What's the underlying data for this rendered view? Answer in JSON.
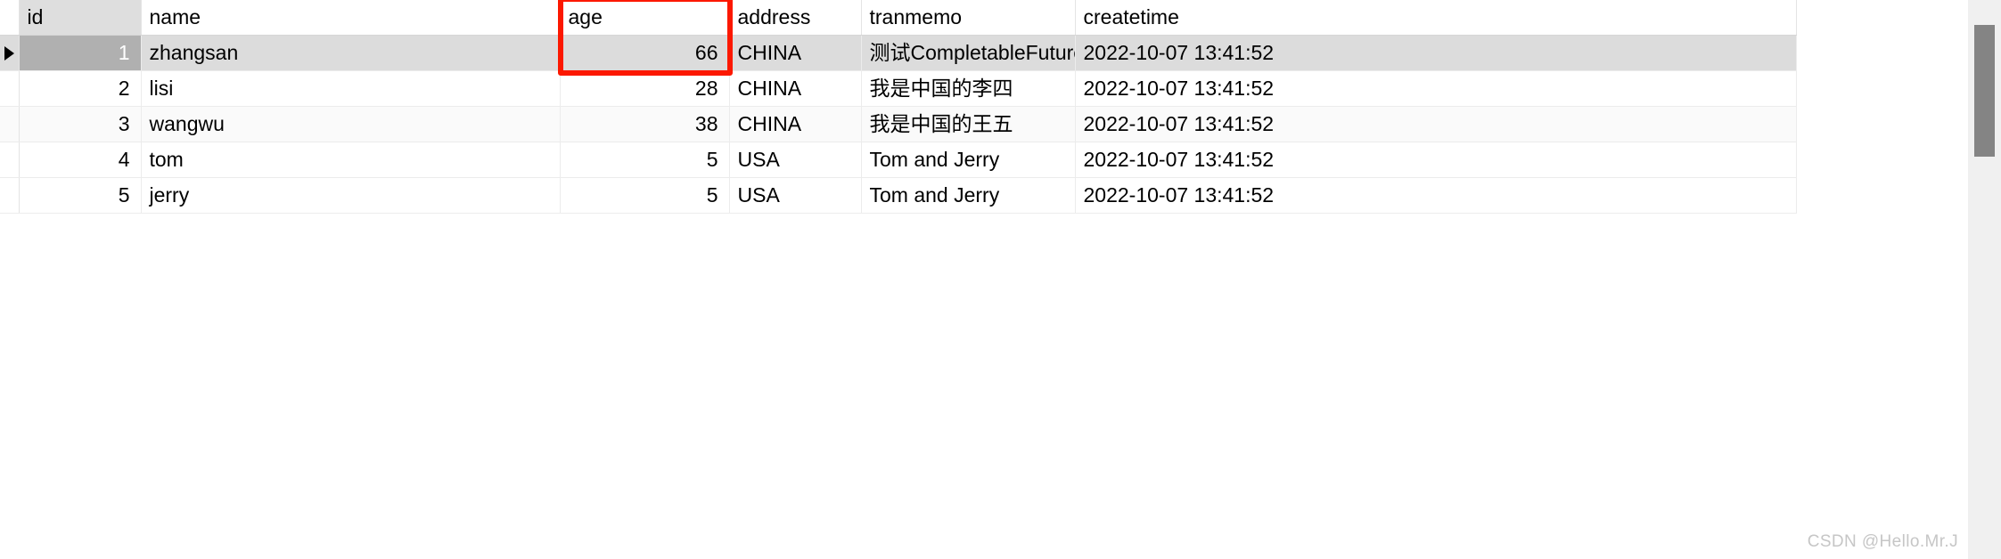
{
  "grid": {
    "columns": [
      {
        "key": "id",
        "label": "id",
        "align": "right"
      },
      {
        "key": "name",
        "label": "name",
        "align": "left"
      },
      {
        "key": "age",
        "label": "age",
        "align": "right"
      },
      {
        "key": "address",
        "label": "address",
        "align": "left"
      },
      {
        "key": "tranmemo",
        "label": "tranmemo",
        "align": "left"
      },
      {
        "key": "createtime",
        "label": "createtime",
        "align": "left"
      }
    ],
    "rows": [
      {
        "id": "1",
        "name": "zhangsan",
        "age": "66",
        "address": "CHINA",
        "tranmemo": "测试CompletableFuture事务问题",
        "createtime": "2022-10-07 13:41:52"
      },
      {
        "id": "2",
        "name": "lisi",
        "age": "28",
        "address": "CHINA",
        "tranmemo": "我是中国的李四",
        "createtime": "2022-10-07 13:41:52"
      },
      {
        "id": "3",
        "name": "wangwu",
        "age": "38",
        "address": "CHINA",
        "tranmemo": "我是中国的王五",
        "createtime": "2022-10-07 13:41:52"
      },
      {
        "id": "4",
        "name": "tom",
        "age": "5",
        "address": "USA",
        "tranmemo": "Tom and Jerry",
        "createtime": "2022-10-07 13:41:52"
      },
      {
        "id": "5",
        "name": "jerry",
        "age": "5",
        "address": "USA",
        "tranmemo": "Tom and Jerry",
        "createtime": "2022-10-07 13:41:52"
      }
    ],
    "selected_row_index": 0,
    "selected_column_key": "id",
    "row_marker_glyph": "▶"
  },
  "annotation": {
    "target_column": "age",
    "color": "#fc1800"
  },
  "colors": {
    "selected_row_bg": "#dcdcdc",
    "selected_cell_bg": "#b0b0b0",
    "header_selected_bg": "#dedede",
    "alt_row_bg": "#fafafa",
    "scrollbar_track": "#f0f0f0",
    "scrollbar_thumb": "#848484",
    "watermark": "#c6c6c6"
  },
  "watermark": {
    "text": "CSDN @Hello.Mr.J"
  }
}
